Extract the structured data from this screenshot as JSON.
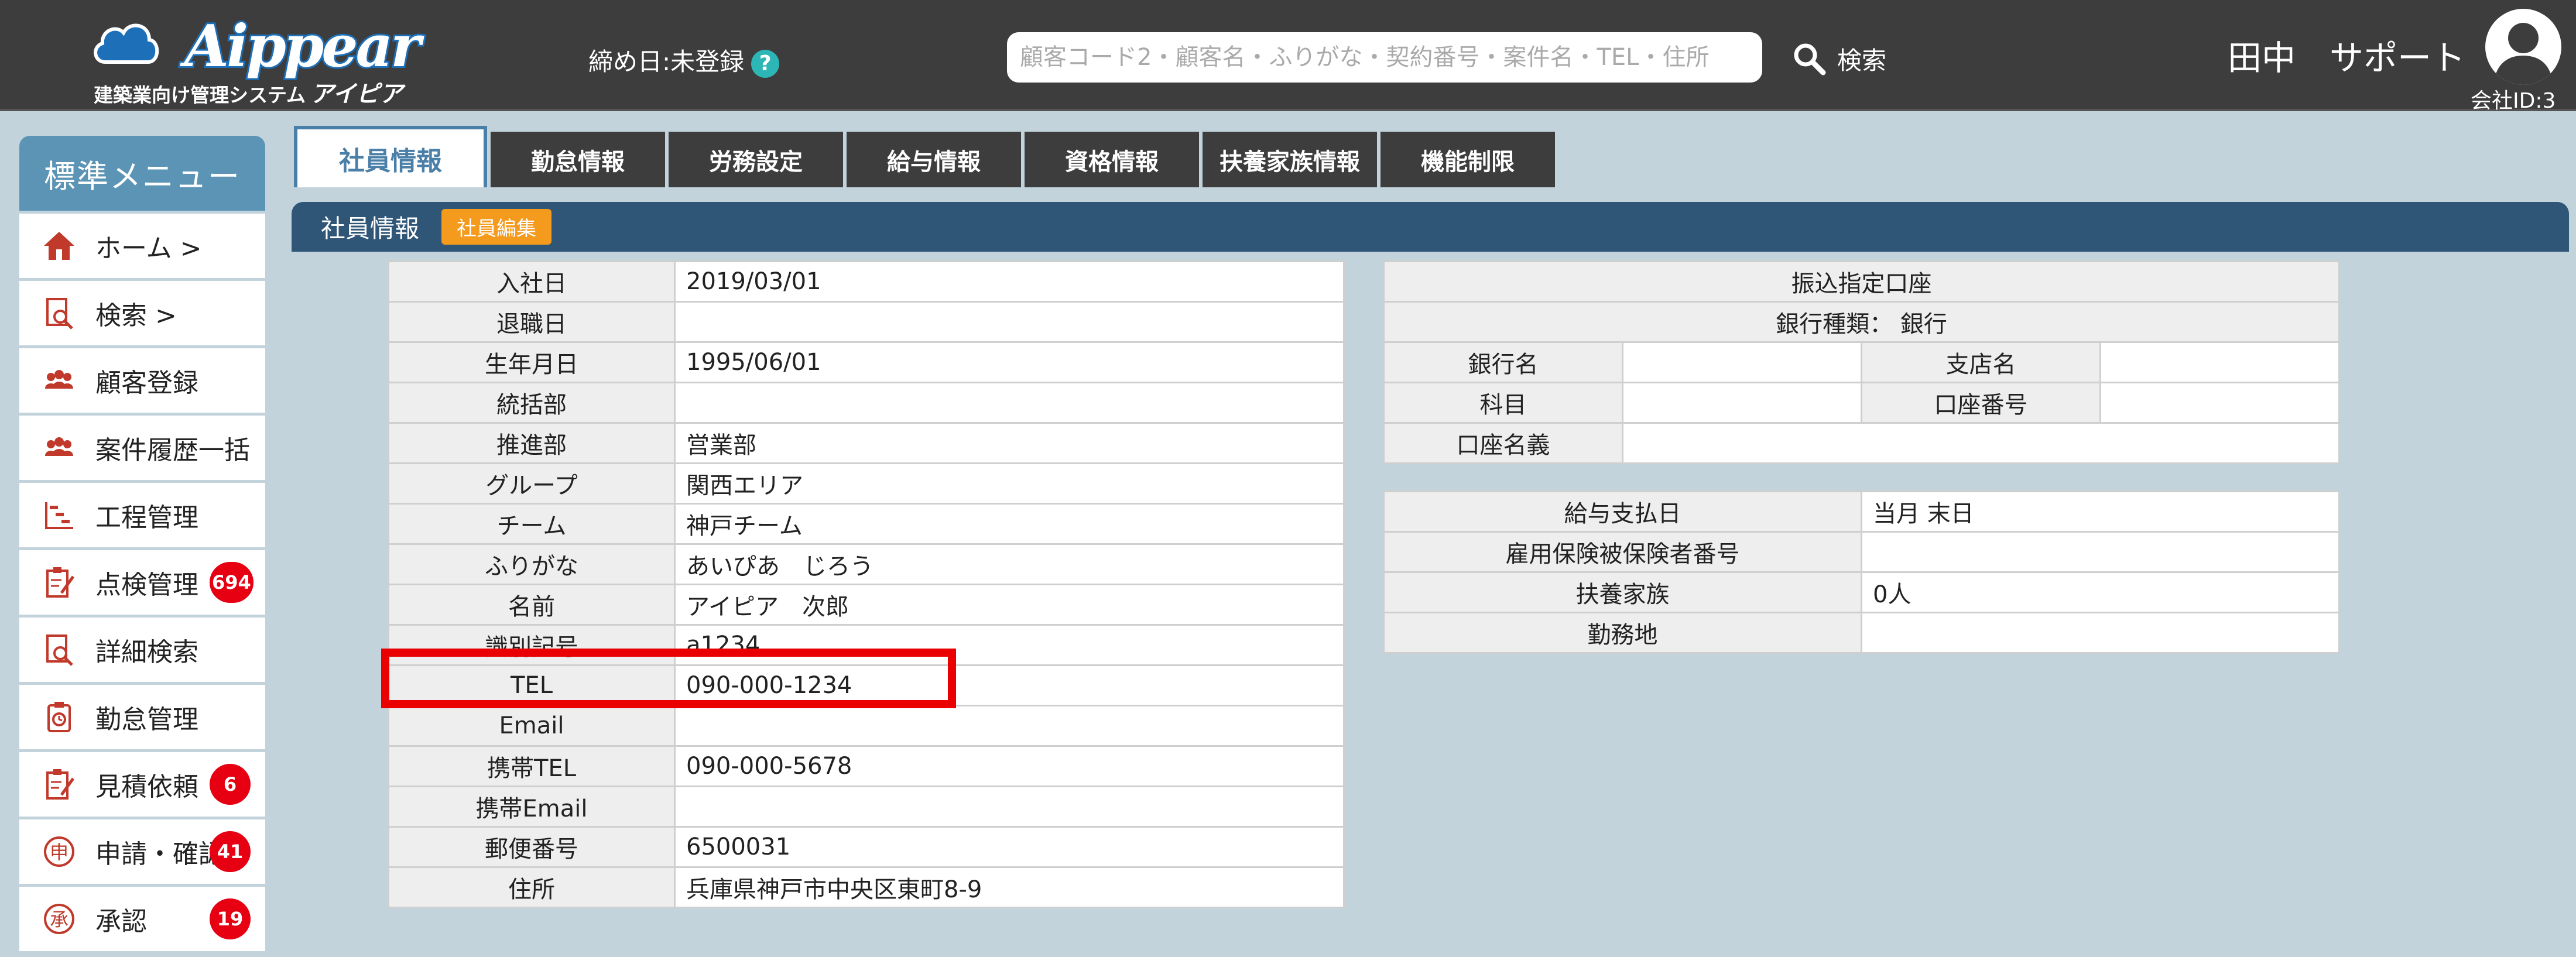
{
  "header": {
    "logo_text": "Aippear",
    "logo_sub": "建築業向け管理システム",
    "logo_kana": "アイピア",
    "deadline": "締め日:未登録",
    "help_glyph": "?",
    "search_placeholder": "顧客コード2・顧客名・ふりがな・契約番号・案件名・TEL・住所",
    "search_label": "検索",
    "user_name": "田中　サポート",
    "company_id": "会社ID:3"
  },
  "sidebar": {
    "title": "標準メニュー",
    "items": [
      {
        "label": "ホーム >",
        "icon": "home-icon",
        "badge": ""
      },
      {
        "label": "検索 >",
        "icon": "search-doc-icon",
        "badge": ""
      },
      {
        "label": "顧客登録",
        "icon": "people-icon",
        "badge": ""
      },
      {
        "label": "案件履歴一括",
        "icon": "people-icon",
        "badge": ""
      },
      {
        "label": "工程管理",
        "icon": "gantt-icon",
        "badge": ""
      },
      {
        "label": "点検管理",
        "icon": "clipboard-icon",
        "badge": "694"
      },
      {
        "label": "詳細検索",
        "icon": "search-doc-icon",
        "badge": ""
      },
      {
        "label": "勤怠管理",
        "icon": "timecard-icon",
        "badge": ""
      },
      {
        "label": "見積依頼",
        "icon": "clipboard-icon",
        "badge": "6"
      },
      {
        "label": "申請・確認",
        "icon": "apply-seal-icon",
        "badge": "41"
      },
      {
        "label": "承認",
        "icon": "approve-seal-icon",
        "badge": "19"
      }
    ]
  },
  "tabs": [
    {
      "label": "社員情報",
      "active": true
    },
    {
      "label": "勤怠情報",
      "active": false
    },
    {
      "label": "労務設定",
      "active": false
    },
    {
      "label": "給与情報",
      "active": false
    },
    {
      "label": "資格情報",
      "active": false
    },
    {
      "label": "扶養家族情報",
      "active": false
    },
    {
      "label": "機能制限",
      "active": false
    }
  ],
  "subbar": {
    "title": "社員情報",
    "edit_button": "社員編集"
  },
  "employee": [
    {
      "label": "入社日",
      "value": "2019/03/01"
    },
    {
      "label": "退職日",
      "value": ""
    },
    {
      "label": "生年月日",
      "value": "1995/06/01"
    },
    {
      "label": "統括部",
      "value": ""
    },
    {
      "label": "推進部",
      "value": "営業部"
    },
    {
      "label": "グループ",
      "value": "関西エリア"
    },
    {
      "label": "チーム",
      "value": "神戸チーム"
    },
    {
      "label": "ふりがな",
      "value": "あいぴあ　じろう"
    },
    {
      "label": "名前",
      "value": "アイピア　次郎"
    },
    {
      "label": "識別記号",
      "value": "a1234"
    },
    {
      "label": "TEL",
      "value": "090-000-1234"
    },
    {
      "label": "Email",
      "value": ""
    },
    {
      "label": "携帯TEL",
      "value": "090-000-5678"
    },
    {
      "label": "携帯Email",
      "value": ""
    },
    {
      "label": "郵便番号",
      "value": "6500031"
    },
    {
      "label": "住所",
      "value": "兵庫県神戸市中央区東町8-9"
    }
  ],
  "bank": {
    "title": "振込指定口座",
    "type_row": "銀行種類： 銀行",
    "bank_name_label": "銀行名",
    "bank_name": "",
    "branch_label": "支店名",
    "branch": "",
    "subject_label": "科目",
    "subject": "",
    "account_no_label": "口座番号",
    "account_no": "",
    "holder_label": "口座名義",
    "holder": ""
  },
  "payroll": [
    {
      "label": "給与支払日",
      "value": "当月 末日"
    },
    {
      "label": "雇用保険被保険者番号",
      "value": ""
    },
    {
      "label": "扶養家族",
      "value": "0人"
    },
    {
      "label": "勤務地",
      "value": ""
    }
  ],
  "colors": {
    "header_bg": "#3d3d3d",
    "subbar_bg": "#2f5577",
    "badge": "#e60012",
    "edit_button": "#f49a1d",
    "highlight": "#ea0000"
  }
}
